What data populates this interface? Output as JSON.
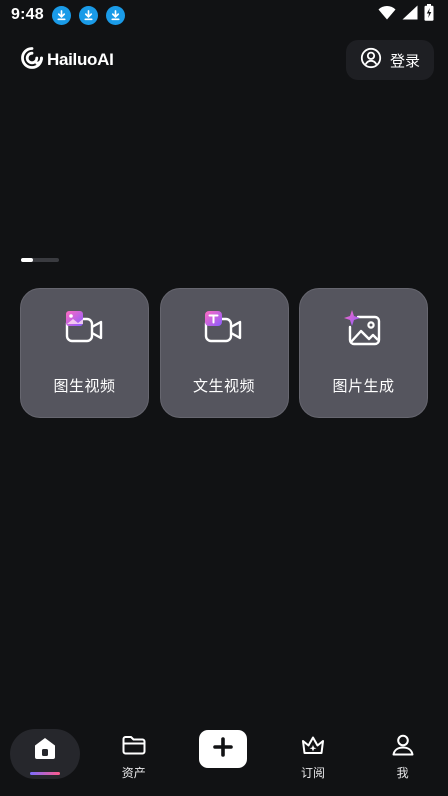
{
  "status_bar": {
    "time": "9:48",
    "download_icons": [
      "download-icon",
      "download-icon",
      "download-icon"
    ],
    "right_icons": [
      "wifi-icon",
      "signal-icon",
      "battery-charging-icon"
    ]
  },
  "header": {
    "logo_text": "HailuoAI",
    "login_label": "登录"
  },
  "features": [
    {
      "label": "图生视频",
      "icon": "image-to-video-icon"
    },
    {
      "label": "文生视频",
      "icon": "text-to-video-icon"
    },
    {
      "label": "图片生成",
      "icon": "image-generation-icon"
    }
  ],
  "bottom_nav": {
    "home_icon": "home-icon",
    "assets_label": "资产",
    "create_icon": "plus-icon",
    "subscribe_label": "订阅",
    "me_label": "我"
  },
  "colors": {
    "background": "#111214",
    "card": "#55555e",
    "status_accent": "#1a9be8",
    "gradient_start": "#7b6cff",
    "gradient_end": "#ff5a8a"
  }
}
